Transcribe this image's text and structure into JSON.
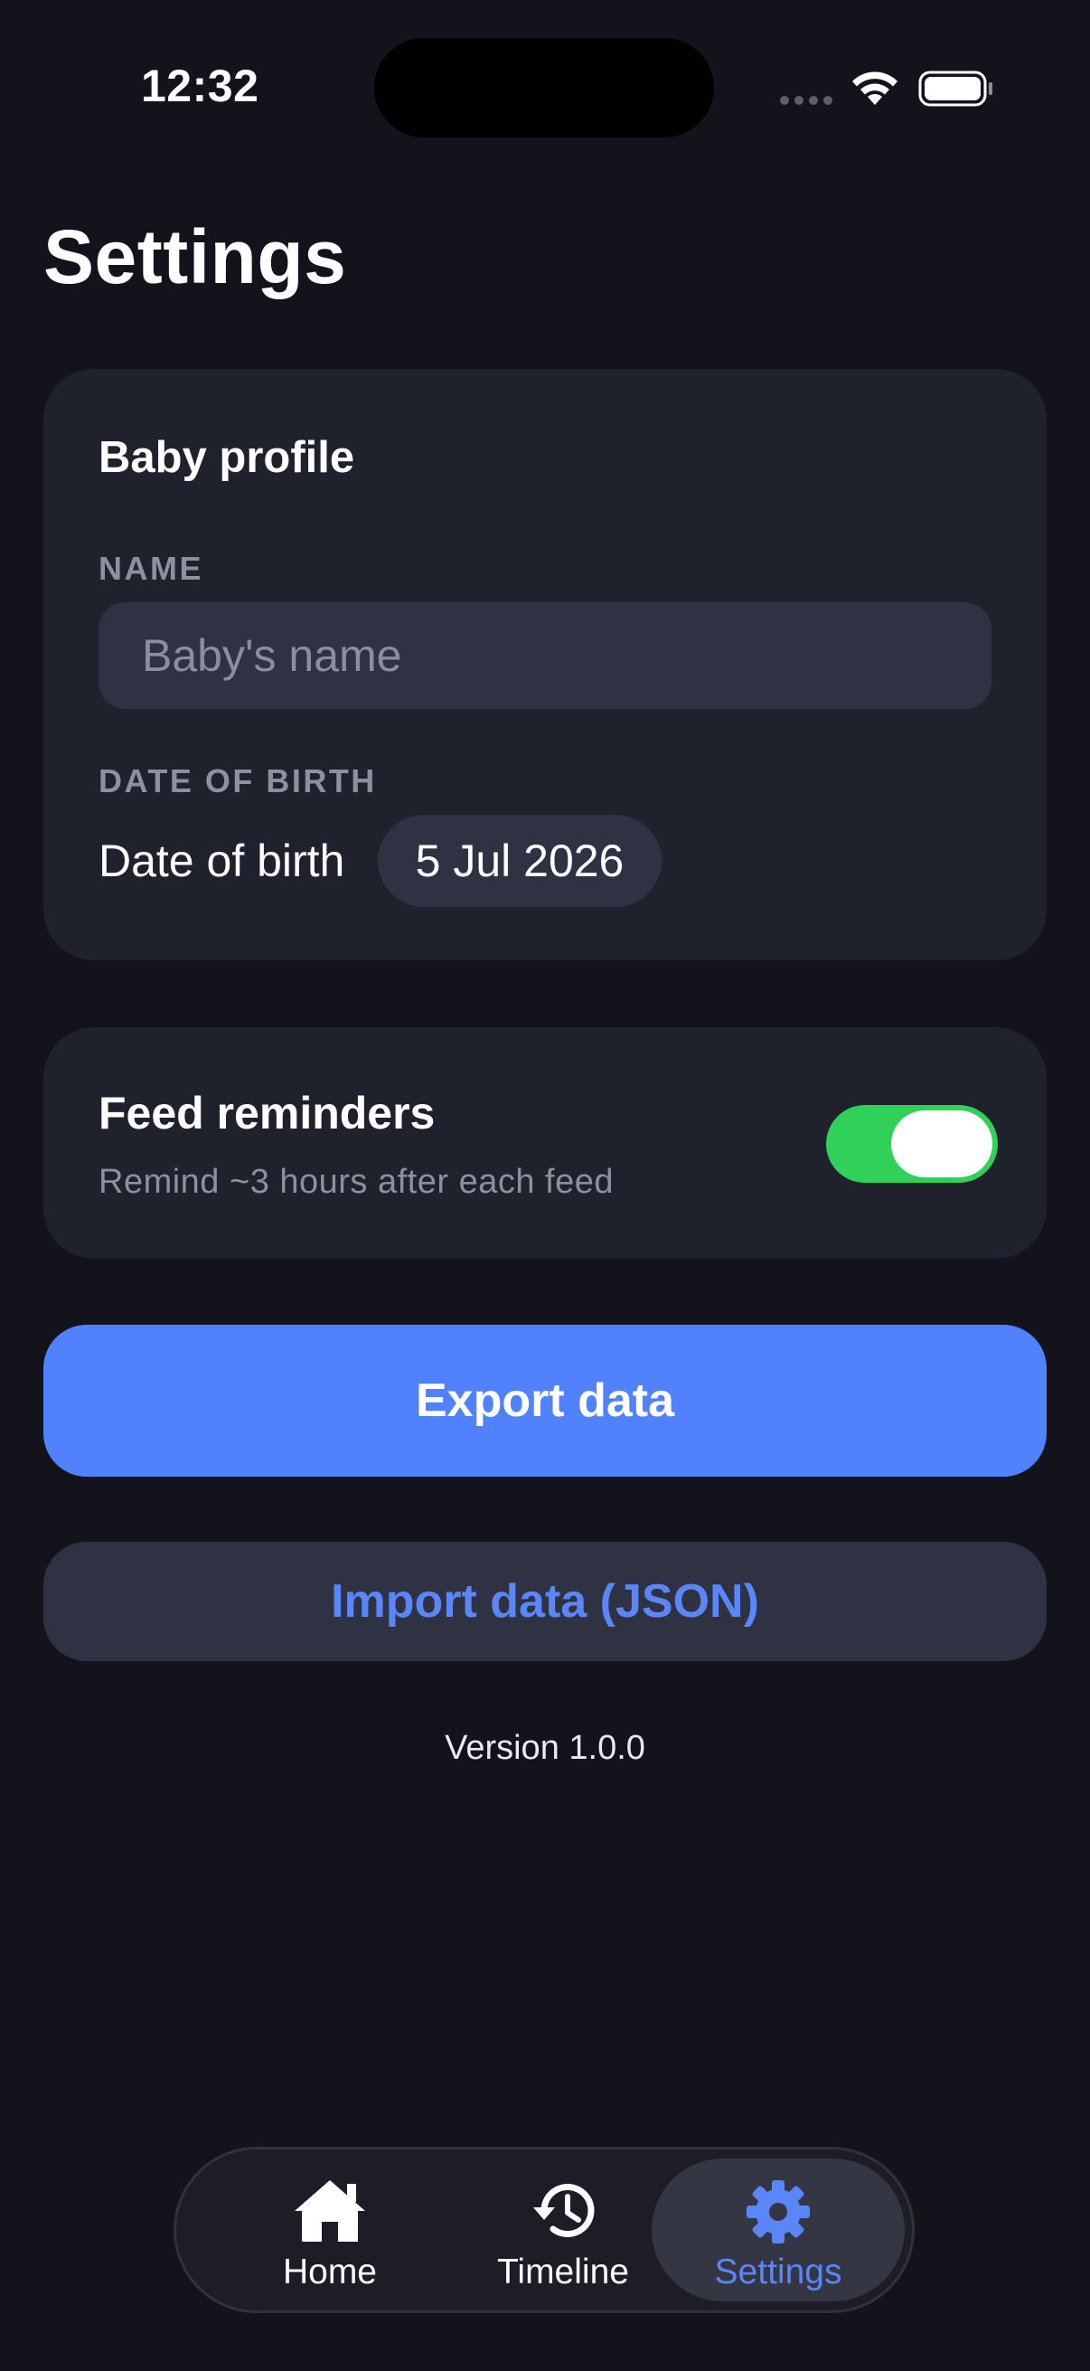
{
  "status_bar": {
    "time": "12:32"
  },
  "page": {
    "title": "Settings"
  },
  "profile_card": {
    "title": "Baby profile",
    "name_label": "NAME",
    "name_placeholder": "Baby's name",
    "name_value": "",
    "dob_label": "DATE OF BIRTH",
    "dob_row_label": "Date of birth",
    "dob_value": "5 Jul 2026"
  },
  "reminders_card": {
    "title": "Feed reminders",
    "subtitle": "Remind ~3 hours after each feed",
    "enabled": true
  },
  "actions": {
    "export_label": "Export data",
    "import_label": "Import data (JSON)"
  },
  "footer": {
    "version": "Version 1.0.0"
  },
  "tab_bar": {
    "items": [
      {
        "label": "Home",
        "icon": "house-icon"
      },
      {
        "label": "Timeline",
        "icon": "history-clock-icon"
      },
      {
        "label": "Settings",
        "icon": "gear-icon",
        "selected": true
      }
    ]
  },
  "colors": {
    "background": "#12131b",
    "card": "#1f212c",
    "accent": "#5081fe",
    "toggle_on": "#30d158",
    "secondary_text": "#8c90a1"
  }
}
